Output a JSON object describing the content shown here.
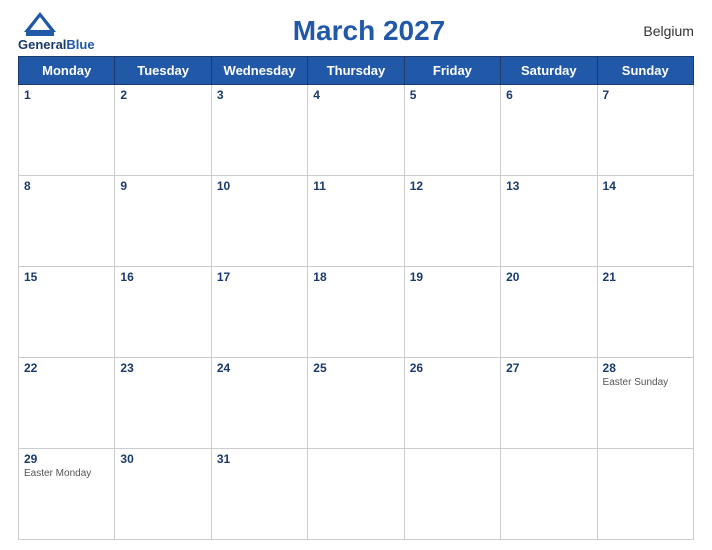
{
  "header": {
    "logo_line1": "General",
    "logo_line2": "Blue",
    "title": "March 2027",
    "country": "Belgium"
  },
  "weekdays": [
    "Monday",
    "Tuesday",
    "Wednesday",
    "Thursday",
    "Friday",
    "Saturday",
    "Sunday"
  ],
  "weeks": [
    [
      {
        "day": "1",
        "holiday": ""
      },
      {
        "day": "2",
        "holiday": ""
      },
      {
        "day": "3",
        "holiday": ""
      },
      {
        "day": "4",
        "holiday": ""
      },
      {
        "day": "5",
        "holiday": ""
      },
      {
        "day": "6",
        "holiday": ""
      },
      {
        "day": "7",
        "holiday": ""
      }
    ],
    [
      {
        "day": "8",
        "holiday": ""
      },
      {
        "day": "9",
        "holiday": ""
      },
      {
        "day": "10",
        "holiday": ""
      },
      {
        "day": "11",
        "holiday": ""
      },
      {
        "day": "12",
        "holiday": ""
      },
      {
        "day": "13",
        "holiday": ""
      },
      {
        "day": "14",
        "holiday": ""
      }
    ],
    [
      {
        "day": "15",
        "holiday": ""
      },
      {
        "day": "16",
        "holiday": ""
      },
      {
        "day": "17",
        "holiday": ""
      },
      {
        "day": "18",
        "holiday": ""
      },
      {
        "day": "19",
        "holiday": ""
      },
      {
        "day": "20",
        "holiday": ""
      },
      {
        "day": "21",
        "holiday": ""
      }
    ],
    [
      {
        "day": "22",
        "holiday": ""
      },
      {
        "day": "23",
        "holiday": ""
      },
      {
        "day": "24",
        "holiday": ""
      },
      {
        "day": "25",
        "holiday": ""
      },
      {
        "day": "26",
        "holiday": ""
      },
      {
        "day": "27",
        "holiday": ""
      },
      {
        "day": "28",
        "holiday": "Easter Sunday"
      }
    ],
    [
      {
        "day": "29",
        "holiday": "Easter Monday"
      },
      {
        "day": "30",
        "holiday": ""
      },
      {
        "day": "31",
        "holiday": ""
      },
      {
        "day": "",
        "holiday": ""
      },
      {
        "day": "",
        "holiday": ""
      },
      {
        "day": "",
        "holiday": ""
      },
      {
        "day": "",
        "holiday": ""
      }
    ]
  ]
}
